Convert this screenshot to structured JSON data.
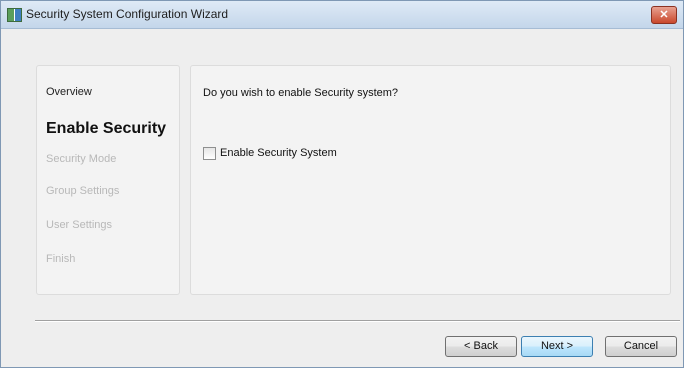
{
  "window": {
    "title": "Security System Configuration Wizard",
    "close_glyph": "✕"
  },
  "nav": {
    "items": [
      {
        "label": "Overview",
        "state": "visited"
      },
      {
        "label": "Enable Security",
        "state": "current"
      },
      {
        "label": "Security Mode",
        "state": "disabled"
      },
      {
        "label": "Group Settings",
        "state": "disabled"
      },
      {
        "label": "User Settings",
        "state": "disabled"
      },
      {
        "label": "Finish",
        "state": "disabled"
      }
    ]
  },
  "content": {
    "question": "Do you wish to enable Security system?",
    "checkbox_label": "Enable Security System",
    "checkbox_checked": false
  },
  "buttons": {
    "back": "< Back",
    "next": "Next >",
    "cancel": "Cancel"
  },
  "colors": {
    "disabled_text": "#b8b8b8",
    "default_button_border": "#3c7fb1",
    "close_button": "#c9482c"
  }
}
